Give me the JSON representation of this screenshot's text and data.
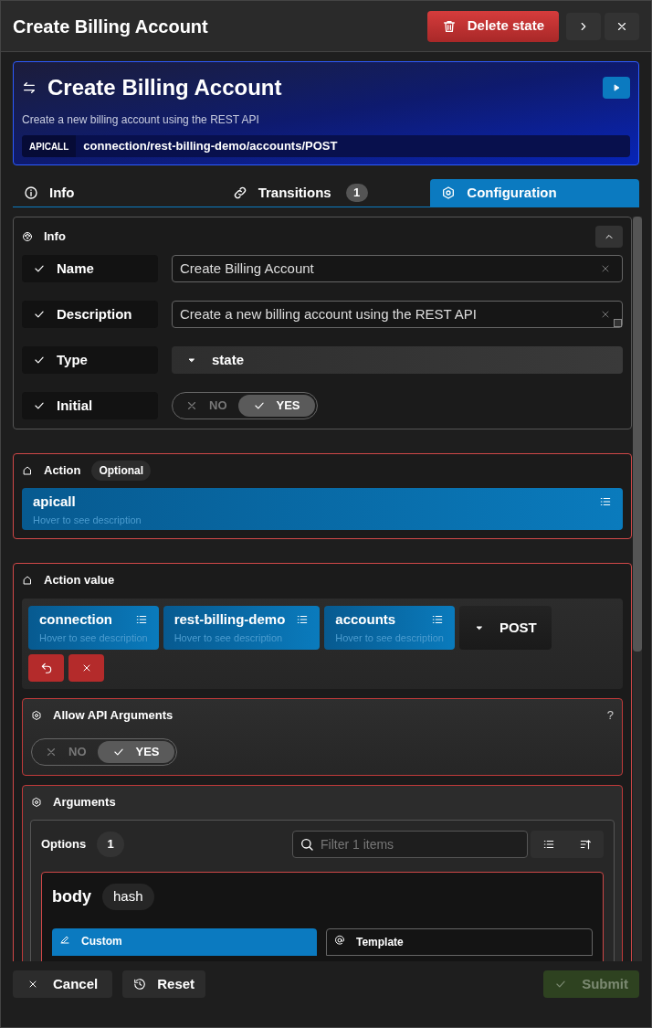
{
  "dialog": {
    "title": "Create Billing Account",
    "delete_label": "Delete state"
  },
  "hero": {
    "title": "Create Billing Account",
    "description": "Create a new billing account using the REST API",
    "tag": "APICALL",
    "path": "connection/rest-billing-demo/accounts/POST"
  },
  "tabs": [
    {
      "label": "Info",
      "selected": false
    },
    {
      "label": "Transitions",
      "badge": "1",
      "selected": false
    },
    {
      "label": "Configuration",
      "selected": true
    }
  ],
  "info_section": {
    "title": "Info",
    "expanded": true,
    "fields": [
      {
        "label": "Name",
        "kind": "text",
        "value": "Create Billing Account"
      },
      {
        "label": "Description",
        "kind": "textarea",
        "value": "Create a new billing account using the REST API"
      },
      {
        "label": "Type",
        "kind": "select",
        "value": "state"
      },
      {
        "label": "Initial",
        "kind": "toggle",
        "no_label": "NO",
        "yes_label": "YES",
        "on": true
      }
    ]
  },
  "action_section": {
    "title": "Action",
    "badge": "Optional",
    "option": {
      "value": "apicall",
      "hint": "Hover to see description"
    }
  },
  "action_value_section": {
    "title": "Action value",
    "parts": [
      {
        "value": "connection",
        "hint": "Hover to see description"
      },
      {
        "value": "rest-billing-demo",
        "hint": "Hover to see description"
      },
      {
        "value": "accounts",
        "hint": "Hover to see description"
      }
    ],
    "method": "POST"
  },
  "allow_args_section": {
    "title": "Allow API Arguments",
    "help": "?",
    "no_label": "NO",
    "yes_label": "YES",
    "on": true
  },
  "arguments_section": {
    "title": "Arguments",
    "options_label": "Options",
    "count": "1",
    "filter_placeholder": "Filter 1 items",
    "item": {
      "name": "body",
      "type": "hash",
      "modes": [
        {
          "label": "Custom",
          "selected": true
        },
        {
          "label": "Template",
          "selected": false
        }
      ]
    }
  },
  "footer": {
    "cancel": "Cancel",
    "reset": "Reset",
    "submit": {
      "label": "Submit",
      "disabled": true
    }
  }
}
